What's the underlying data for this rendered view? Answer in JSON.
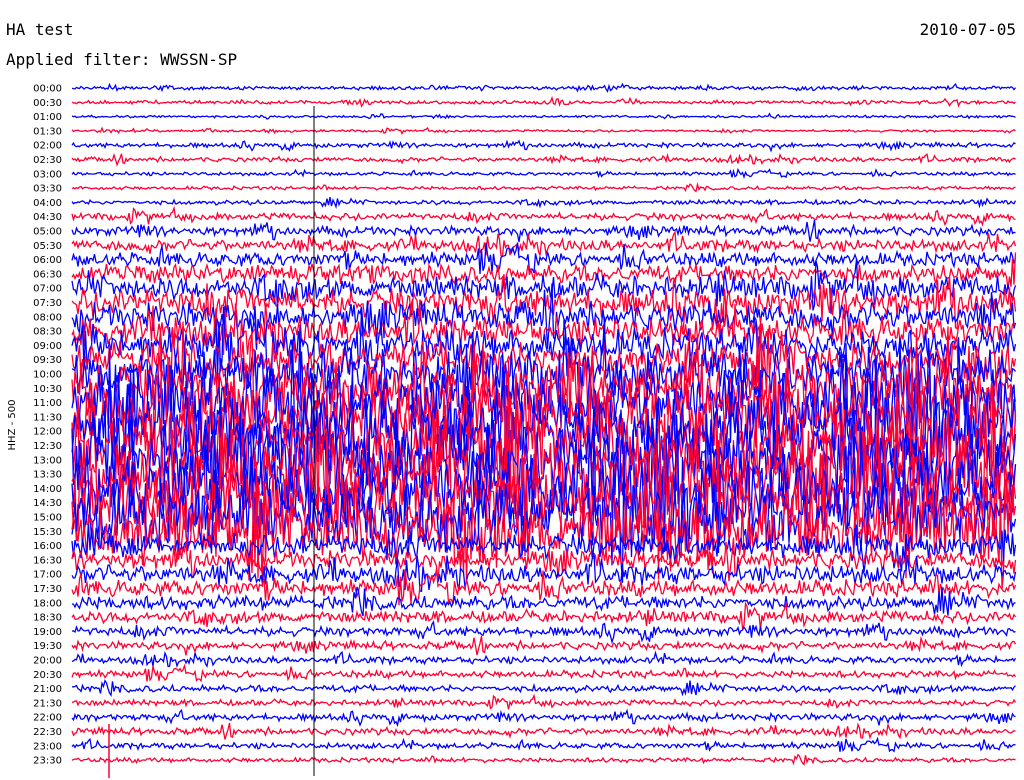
{
  "header": {
    "title": "HA test",
    "date": "2010-07-05",
    "filter": "Applied filter: WWSSN-SP"
  },
  "chart_data": {
    "type": "line",
    "ylabel": "HHZ - 500",
    "colors": [
      "#0000ff",
      "#ff0033"
    ],
    "row_labels": [
      "00:00",
      "00:30",
      "01:00",
      "01:30",
      "02:00",
      "02:30",
      "03:00",
      "03:30",
      "04:00",
      "04:30",
      "05:00",
      "05:30",
      "06:00",
      "06:30",
      "07:00",
      "07:30",
      "08:00",
      "08:30",
      "09:00",
      "09:30",
      "10:00",
      "10:30",
      "11:00",
      "11:30",
      "12:00",
      "12:30",
      "13:00",
      "13:30",
      "14:00",
      "14:30",
      "15:00",
      "15:30",
      "16:00",
      "16:30",
      "17:00",
      "17:30",
      "18:00",
      "18:30",
      "19:00",
      "19:30",
      "20:00",
      "20:30",
      "21:00",
      "21:30",
      "22:00",
      "22:30",
      "23:00",
      "23:30"
    ],
    "row_amplitude": [
      1.5,
      1.5,
      1,
      1,
      2,
      2,
      1.5,
      1.5,
      2,
      3,
      4,
      5,
      6,
      8,
      10,
      12,
      12,
      12,
      14,
      16,
      20,
      24,
      28,
      32,
      32,
      32,
      32,
      32,
      32,
      32,
      30,
      26,
      10,
      8,
      8,
      7,
      6,
      5,
      4,
      3.5,
      3,
      3,
      3,
      2.5,
      3,
      3,
      2.5,
      2
    ]
  }
}
